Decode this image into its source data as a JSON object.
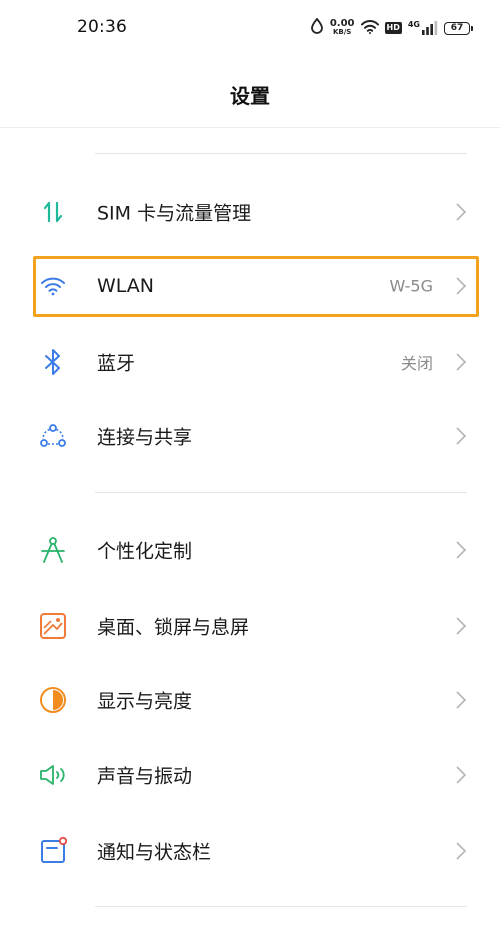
{
  "status_bar": {
    "time": "20:36",
    "net_speed_value": "0.00",
    "net_speed_unit": "KB/S",
    "hd_badge": "HD",
    "network_type": "4G",
    "battery_level": "67"
  },
  "header": {
    "title": "设置"
  },
  "settings": {
    "sim": {
      "label": "SIM 卡与流量管理"
    },
    "wlan": {
      "label": "WLAN",
      "value": "W-5G"
    },
    "bluetooth": {
      "label": "蓝牙",
      "value": "关闭"
    },
    "connection": {
      "label": "连接与共享"
    },
    "personalize": {
      "label": "个性化定制"
    },
    "desktop": {
      "label": "桌面、锁屏与息屏"
    },
    "display": {
      "label": "显示与亮度"
    },
    "sound": {
      "label": "声音与振动"
    },
    "notification": {
      "label": "通知与状态栏"
    }
  },
  "colors": {
    "highlight": "#f2a21c",
    "sim_icon": "#1fb89a",
    "wifi_icon": "#3b7ce6",
    "bluetooth_icon": "#3b7ce6",
    "connection_icon": "#3b7ce6",
    "personalize_icon": "#27b36a",
    "desktop_icon": "#f07a3a",
    "display_icon": "#f28c1e",
    "sound_icon": "#27b36a",
    "notification_icon": "#3b7ce6",
    "notification_dot": "#e84a4a"
  }
}
